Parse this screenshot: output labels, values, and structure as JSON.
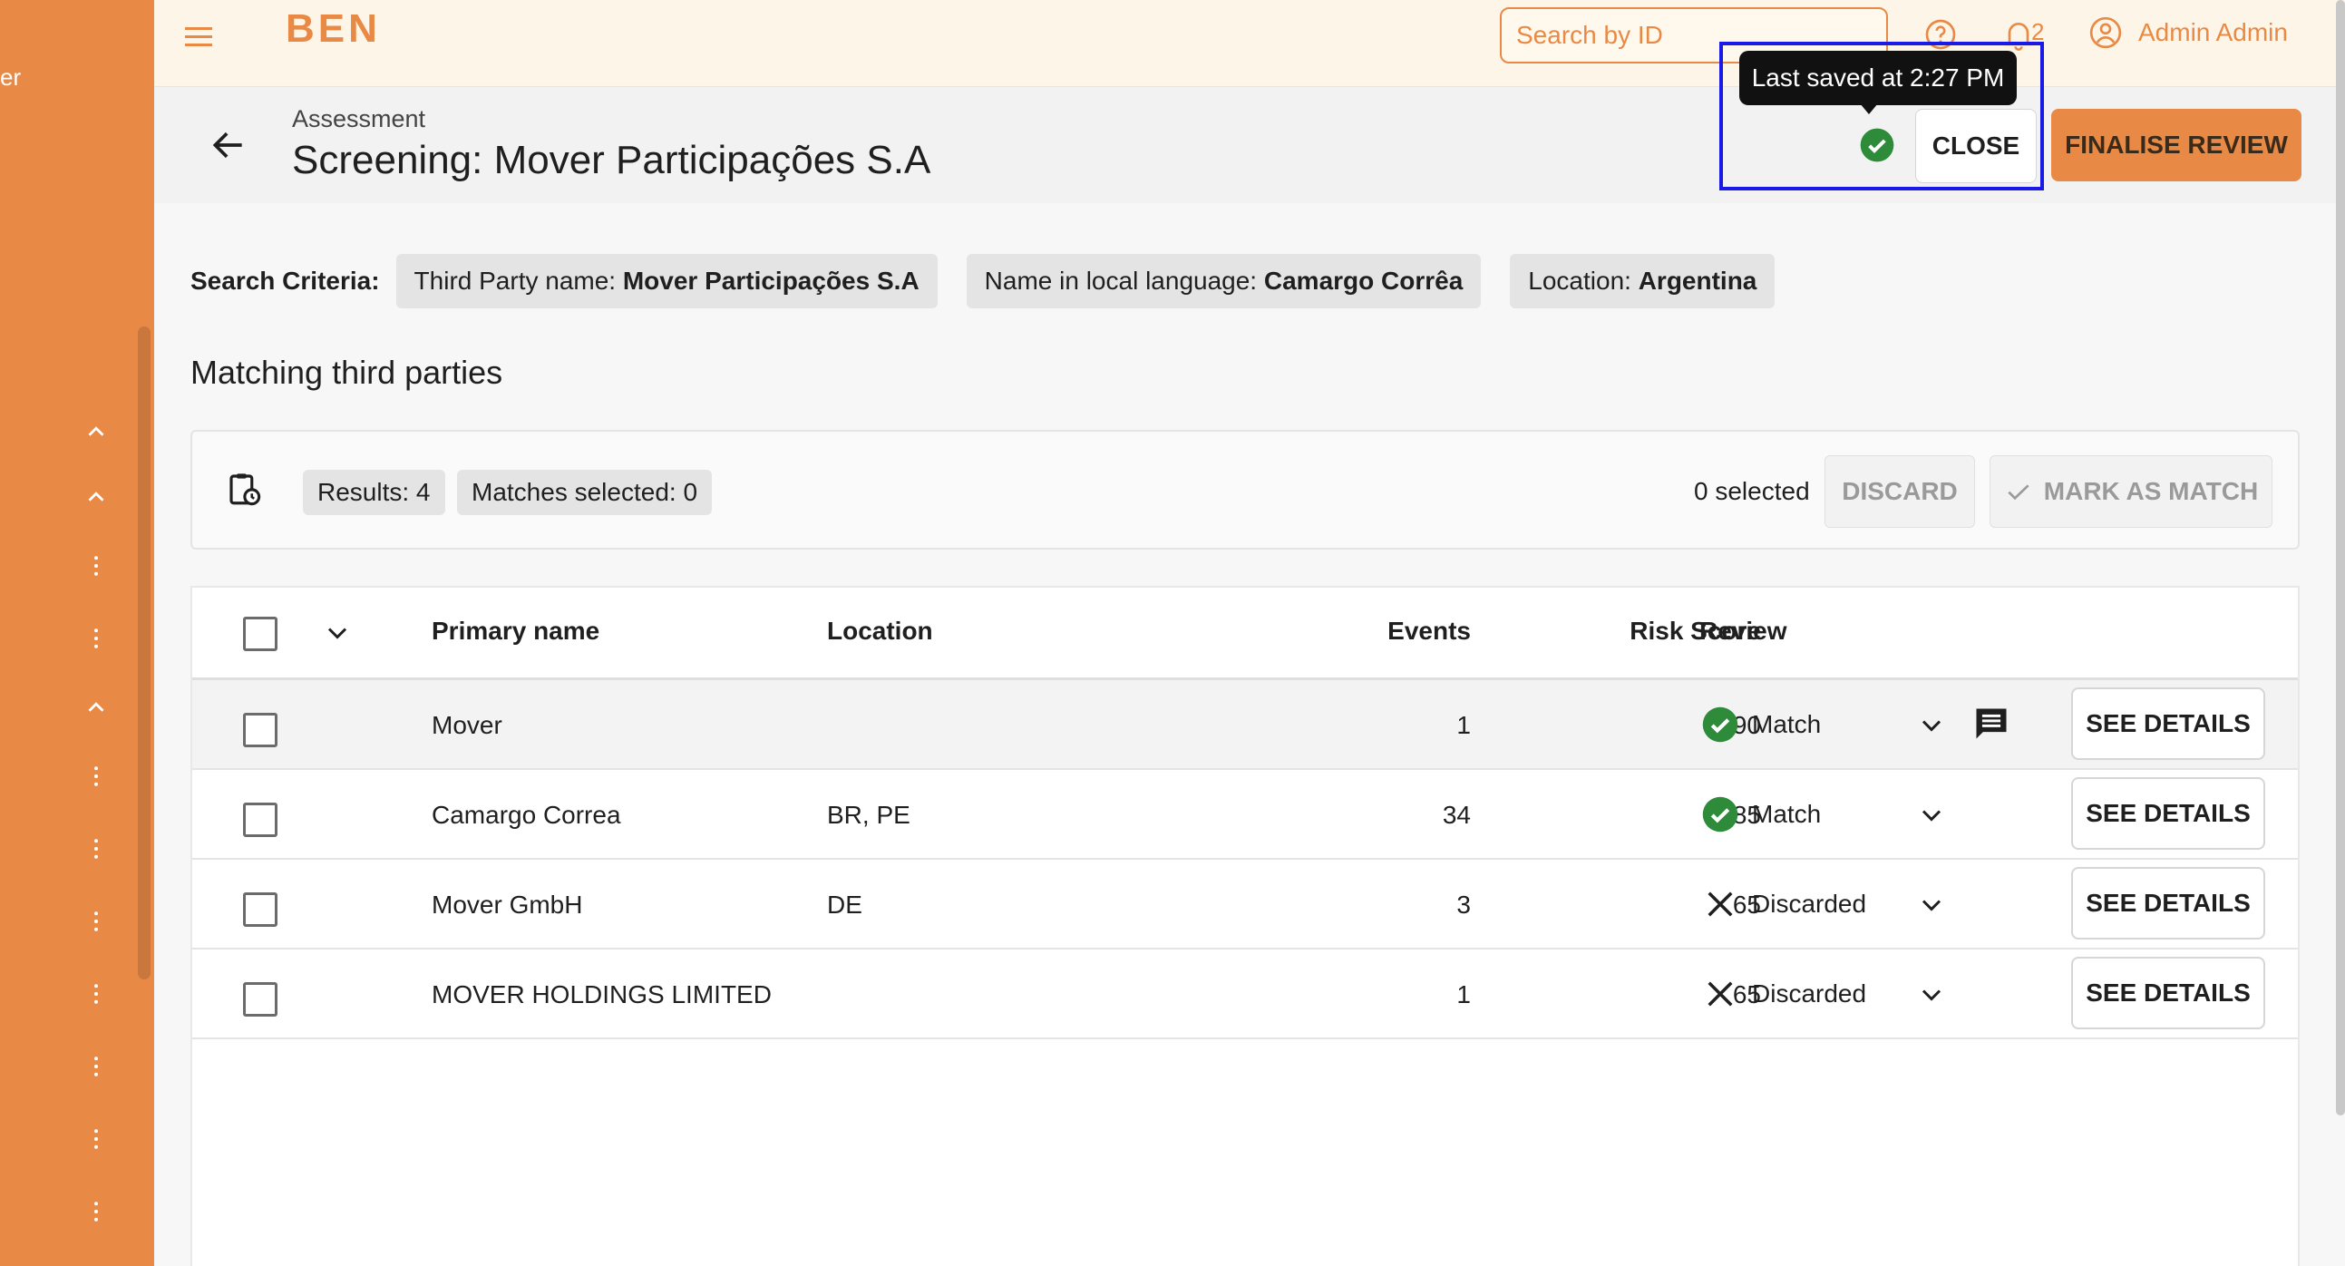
{
  "sidebar": {
    "peek_text": "er"
  },
  "topbar": {
    "logo_text": "BEN",
    "search_placeholder": "Search by ID",
    "notification_count": "2",
    "user_name": "Admin Admin"
  },
  "header": {
    "breadcrumb": "Assessment",
    "title": "Screening: Mover Participações S.A",
    "tooltip": "Last saved at 2:27 PM",
    "close_label": "CLOSE",
    "finalise_label": "FINALISE REVIEW"
  },
  "criteria": {
    "label": "Search Criteria:",
    "chips": [
      {
        "key": "Third Party name: ",
        "value": "Mover Participações S.A"
      },
      {
        "key": "Name in local language: ",
        "value": "Camargo Corrêa"
      },
      {
        "key": "Location: ",
        "value": "Argentina"
      }
    ]
  },
  "section_title": "Matching third parties",
  "results_bar": {
    "results": "Results: 4",
    "matches_selected": "Matches selected: 0",
    "selected_count": "0 selected",
    "discard_label": "DISCARD",
    "mark_label": "MARK AS MATCH"
  },
  "table": {
    "columns": {
      "primary_name": "Primary name",
      "location": "Location",
      "events": "Events",
      "risk_score": "Risk Score",
      "review": "Review"
    },
    "see_details_label": "SEE DETAILS",
    "rows": [
      {
        "name": "Mover",
        "location": "",
        "events": "1",
        "risk": "90",
        "review": "Match",
        "status": "match",
        "has_comment": true
      },
      {
        "name": "Camargo Correa",
        "location": "BR, PE",
        "events": "34",
        "risk": "85",
        "review": "Match",
        "status": "match",
        "has_comment": false
      },
      {
        "name": "Mover GmbH",
        "location": "DE",
        "events": "3",
        "risk": "65",
        "review": "Discarded",
        "status": "discarded",
        "has_comment": false
      },
      {
        "name": "MOVER HOLDINGS LIMITED",
        "location": "",
        "events": "1",
        "risk": "65",
        "review": "Discarded",
        "status": "discarded",
        "has_comment": false
      }
    ]
  },
  "colors": {
    "accent": "#e88a45",
    "match": "#2e8b3a",
    "highlight": "#1a1ae6"
  }
}
